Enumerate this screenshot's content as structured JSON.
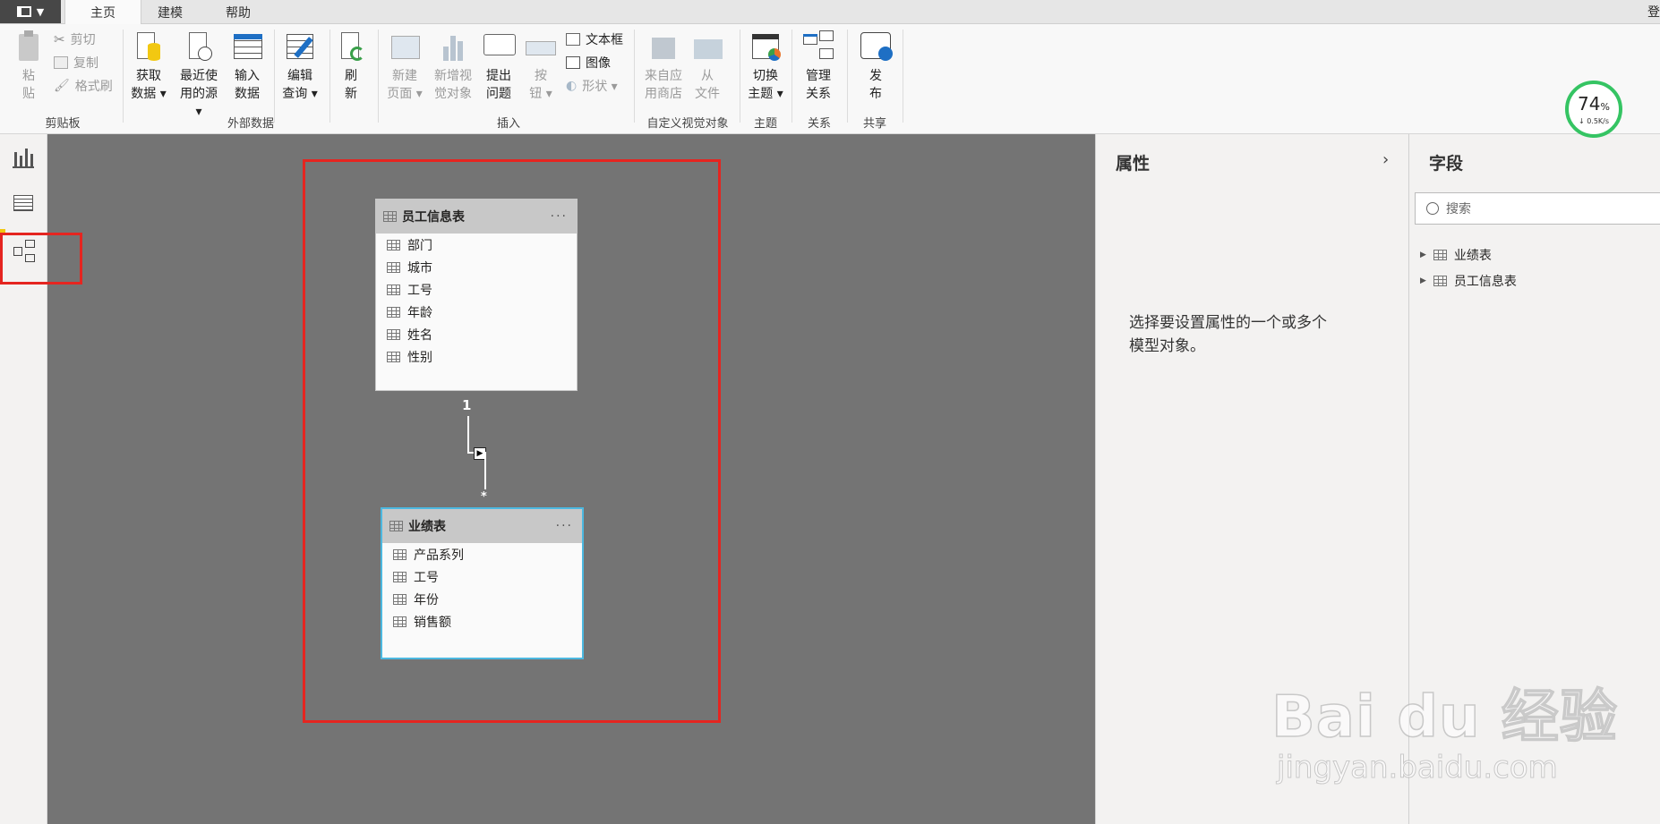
{
  "menu": {
    "tabs": [
      "主页",
      "建模",
      "帮助"
    ],
    "active": "主页",
    "right_char": "登"
  },
  "ribbon": {
    "clipboard": {
      "paste": [
        "粘",
        "贴"
      ],
      "cut": "剪切",
      "copy": "复制",
      "format_painter": "格式刷",
      "group": "剪贴板"
    },
    "external": {
      "get_data": [
        "获取",
        "数据"
      ],
      "recent": [
        "最近使",
        "用的源"
      ],
      "enter": [
        "输入",
        "数据"
      ],
      "edit": [
        "编辑",
        "查询"
      ],
      "refresh": [
        "刷",
        "新"
      ],
      "group": "外部数据"
    },
    "insert": {
      "new_page": [
        "新建",
        "页面"
      ],
      "new_visual": [
        "新增视",
        "觉对象"
      ],
      "ask": [
        "提出",
        "问题"
      ],
      "button": [
        "按",
        "钮"
      ],
      "textbox": "文本框",
      "image": "图像",
      "shapes": "形状",
      "group": "插入"
    },
    "custom": {
      "store": [
        "来自应",
        "用商店"
      ],
      "file": [
        "从",
        "文件"
      ],
      "group": "自定义视觉对象"
    },
    "theme": {
      "switch": [
        "切换",
        "主题"
      ],
      "group": "主题"
    },
    "relations": {
      "manage": [
        "管理",
        "关系"
      ],
      "group": "关系"
    },
    "share": {
      "publish": [
        "发",
        "布"
      ],
      "group": "共享"
    }
  },
  "speed_widget": {
    "percent": "74",
    "unit": "%",
    "rate": "0.5K/s"
  },
  "model": {
    "table1": {
      "name": "员工信息表",
      "fields": [
        "部门",
        "城市",
        "工号",
        "年龄",
        "姓名",
        "性别"
      ]
    },
    "table2": {
      "name": "业绩表",
      "fields": [
        "产品系列",
        "工号",
        "年份",
        "销售额"
      ]
    },
    "relationship": {
      "one": "1",
      "many": "*"
    }
  },
  "properties": {
    "title": "属性",
    "message_line1": "选择要设置属性的一个或多个",
    "message_line2": "模型对象。"
  },
  "fields_pane": {
    "title": "字段",
    "search_placeholder": "搜索",
    "tables": [
      "业绩表",
      "员工信息表"
    ]
  },
  "watermark": {
    "brand": "Bai du 经验",
    "url": "jingyan.baidu.com"
  },
  "colors": {
    "highlight_red": "#e52520",
    "canvas": "#747474",
    "selected_border": "#4cb8e0"
  }
}
